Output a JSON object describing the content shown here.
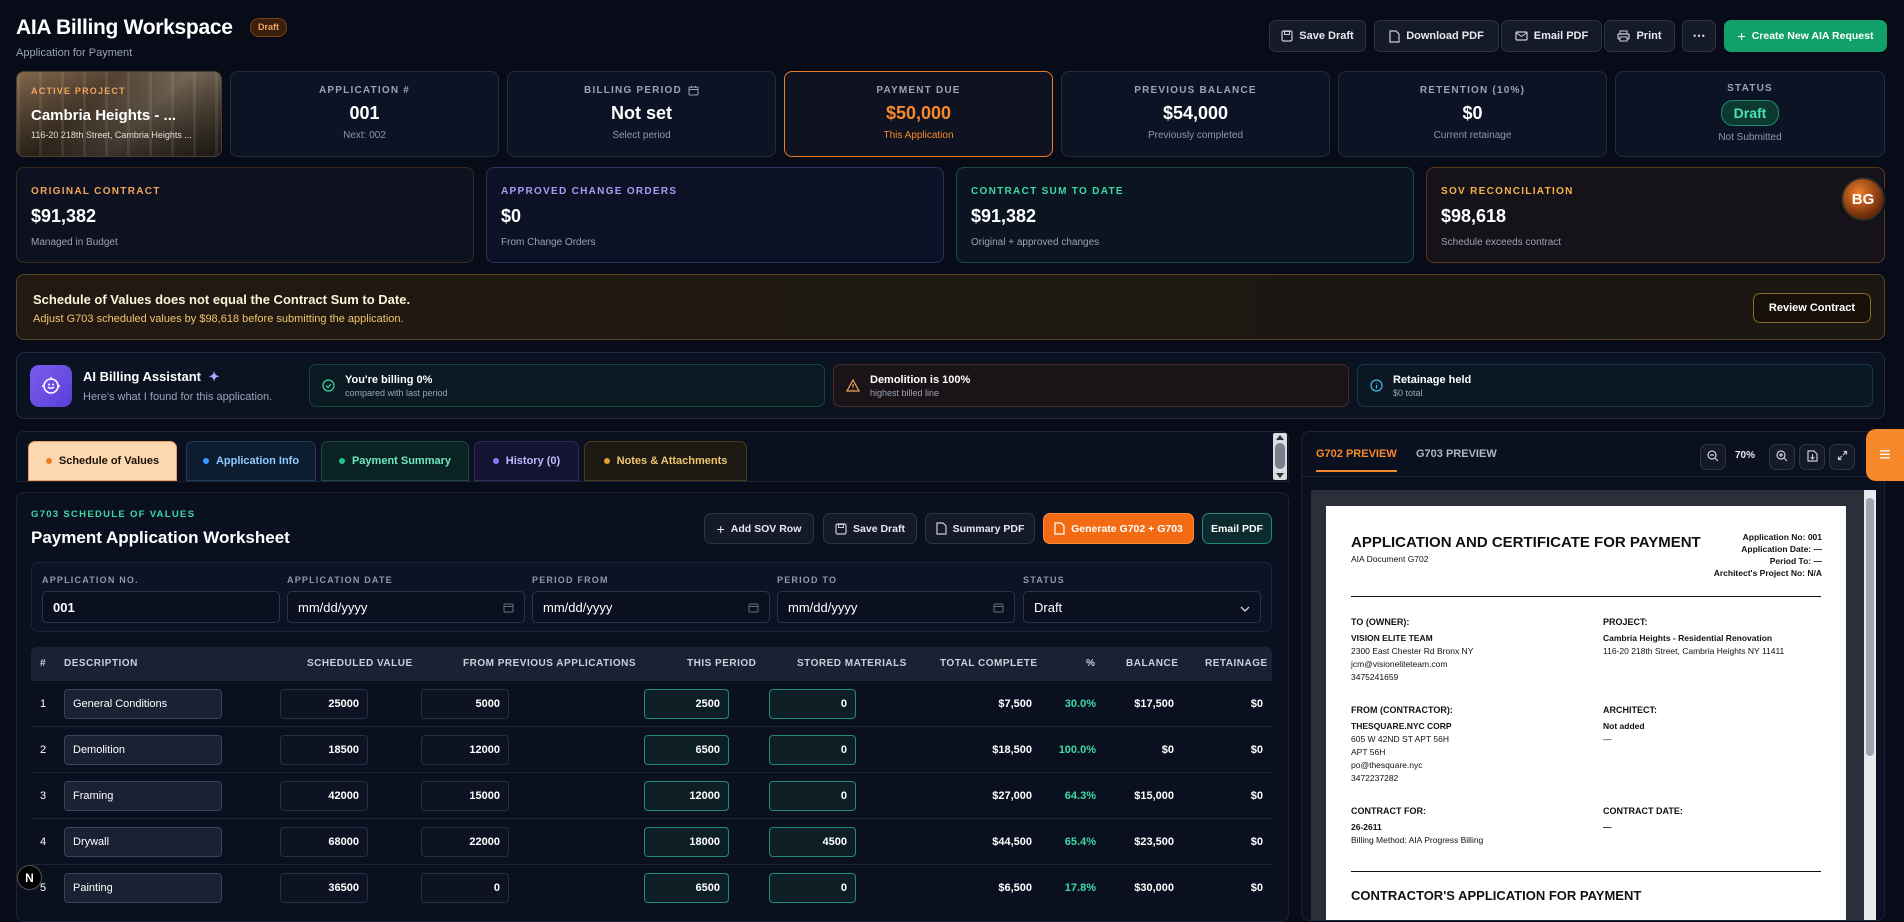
{
  "header": {
    "title": "AIA Billing Workspace",
    "badge": "Draft",
    "subtitle": "Application for Payment",
    "buttons": {
      "save": "Save Draft",
      "download": "Download PDF",
      "email": "Email PDF",
      "print": "Print",
      "more": "⋯",
      "create": "Create New AIA Request"
    }
  },
  "project": {
    "label": "ACTIVE PROJECT",
    "name": "Cambria Heights - ...",
    "address": "116-20 218th Street, Cambria Heights ..."
  },
  "stats": [
    {
      "label": "APPLICATION #",
      "value": "001",
      "sub": "Next: 002"
    },
    {
      "label": "BILLING PERIOD",
      "value": "Not set",
      "sub": "Select period"
    },
    {
      "label": "PAYMENT DUE",
      "value": "$50,000",
      "sub": "This Application"
    },
    {
      "label": "PREVIOUS BALANCE",
      "value": "$54,000",
      "sub": "Previously completed"
    },
    {
      "label": "RETENTION (10%)",
      "value": "$0",
      "sub": "Current retainage"
    },
    {
      "label": "STATUS",
      "value": "Draft",
      "sub": "Not Submitted"
    }
  ],
  "contract": [
    {
      "label": "ORIGINAL CONTRACT",
      "value": "$91,382",
      "sub": "Managed in Budget",
      "color": "#f2a35c"
    },
    {
      "label": "APPROVED CHANGE ORDERS",
      "value": "$0",
      "sub": "From Change Orders",
      "color": "#a99cf5"
    },
    {
      "label": "CONTRACT SUM TO DATE",
      "value": "$91,382",
      "sub": "Original + approved changes",
      "color": "#3fd9a4"
    },
    {
      "label": "SOV RECONCILIATION",
      "value": "$98,618",
      "sub": "Schedule exceeds contract",
      "color": "#f5b24a"
    }
  ],
  "alert": {
    "title": "Schedule of Values does not equal the Contract Sum to Date.",
    "message": "Adjust G703 scheduled values by $98,618 before submitting the application.",
    "button": "Review Contract"
  },
  "assistant": {
    "title": "AI Billing Assistant",
    "sparkle": "✦",
    "subtitle": "Here's what I found for this application.",
    "insights": [
      {
        "title": "You're billing 0%",
        "sub": "compared with last period"
      },
      {
        "title": "Demolition is 100%",
        "sub": "highest billed line"
      },
      {
        "title": "Retainage held",
        "sub": "$0 total"
      }
    ]
  },
  "tabs": [
    {
      "label": "Schedule of Values"
    },
    {
      "label": "Application Info"
    },
    {
      "label": "Payment Summary"
    },
    {
      "label": "History (0)"
    },
    {
      "label": "Notes & Attachments"
    }
  ],
  "worksheet": {
    "kicker": "G703 SCHEDULE OF VALUES",
    "title": "Payment Application Worksheet",
    "buttons": {
      "add": "Add SOV Row",
      "save": "Save Draft",
      "summary": "Summary PDF",
      "generate": "Generate G702 + G703",
      "email": "Email PDF"
    },
    "fields": {
      "app_no_label": "APPLICATION NO.",
      "app_no": "001",
      "app_date_label": "APPLICATION DATE",
      "app_date": "mm/dd/yyyy",
      "from_label": "PERIOD FROM",
      "from": "mm/dd/yyyy",
      "to_label": "PERIOD TO",
      "to": "mm/dd/yyyy",
      "status_label": "STATUS",
      "status": "Draft"
    }
  },
  "table": {
    "headers": [
      "#",
      "DESCRIPTION",
      "SCHEDULED VALUE",
      "FROM PREVIOUS APPLICATIONS",
      "THIS PERIOD",
      "STORED MATERIALS",
      "TOTAL COMPLETE",
      "%",
      "BALANCE",
      "RETAINAGE"
    ],
    "rows": [
      {
        "n": "1",
        "desc": "General Conditions",
        "sched": "25000",
        "prev": "5000",
        "period": "2500",
        "stored": "0",
        "total": "$7,500",
        "pct": "30.0%",
        "bal": "$17,500",
        "ret": "$0"
      },
      {
        "n": "2",
        "desc": "Demolition",
        "sched": "18500",
        "prev": "12000",
        "period": "6500",
        "stored": "0",
        "total": "$18,500",
        "pct": "100.0%",
        "bal": "$0",
        "ret": "$0"
      },
      {
        "n": "3",
        "desc": "Framing",
        "sched": "42000",
        "prev": "15000",
        "period": "12000",
        "stored": "0",
        "total": "$27,000",
        "pct": "64.3%",
        "bal": "$15,000",
        "ret": "$0"
      },
      {
        "n": "4",
        "desc": "Drywall",
        "sched": "68000",
        "prev": "22000",
        "period": "18000",
        "stored": "4500",
        "total": "$44,500",
        "pct": "65.4%",
        "bal": "$23,500",
        "ret": "$0"
      },
      {
        "n": "5",
        "desc": "Painting",
        "sched": "36500",
        "prev": "0",
        "period": "6500",
        "stored": "0",
        "total": "$6,500",
        "pct": "17.8%",
        "bal": "$30,000",
        "ret": "$0"
      }
    ]
  },
  "preview": {
    "tab1": "G702 PREVIEW",
    "tab2": "G703 PREVIEW",
    "zoom": "70%",
    "doc": {
      "title": "APPLICATION AND CERTIFICATE FOR PAYMENT",
      "subtitle": "AIA Document G702",
      "meta": [
        "Application No: 001",
        "Application Date: —",
        "Period To: —",
        "Architect's Project No: N/A"
      ],
      "owner_h": "TO (OWNER):",
      "owner": [
        "VISION ELITE TEAM",
        "2300 East Chester Rd Bronx NY",
        "jcm@visioneliteteam.com",
        "3475241659"
      ],
      "project_h": "PROJECT:",
      "project": [
        "Cambria Heights - Residential Renovation",
        "116-20 218th Street, Cambria Heights NY 11411"
      ],
      "contractor_h": "FROM (CONTRACTOR):",
      "contractor": [
        "THESQUARE.NYC CORP",
        "605 W 42ND ST APT 56H",
        "APT 56H",
        "po@thesquare.nyc",
        "3472237282"
      ],
      "architect_h": "ARCHITECT:",
      "architect": [
        "Not added",
        "—"
      ],
      "contract_h": "CONTRACT FOR:",
      "contract": [
        "26-2611",
        "Billing Method: AIA Progress Billing"
      ],
      "date_h": "CONTRACT DATE:",
      "date": [
        "—"
      ],
      "section": "CONTRACTOR'S APPLICATION FOR PAYMENT"
    }
  },
  "misc": {
    "avatar_initials": "BG",
    "corner_n": "N",
    "menu_icon": "≡"
  }
}
